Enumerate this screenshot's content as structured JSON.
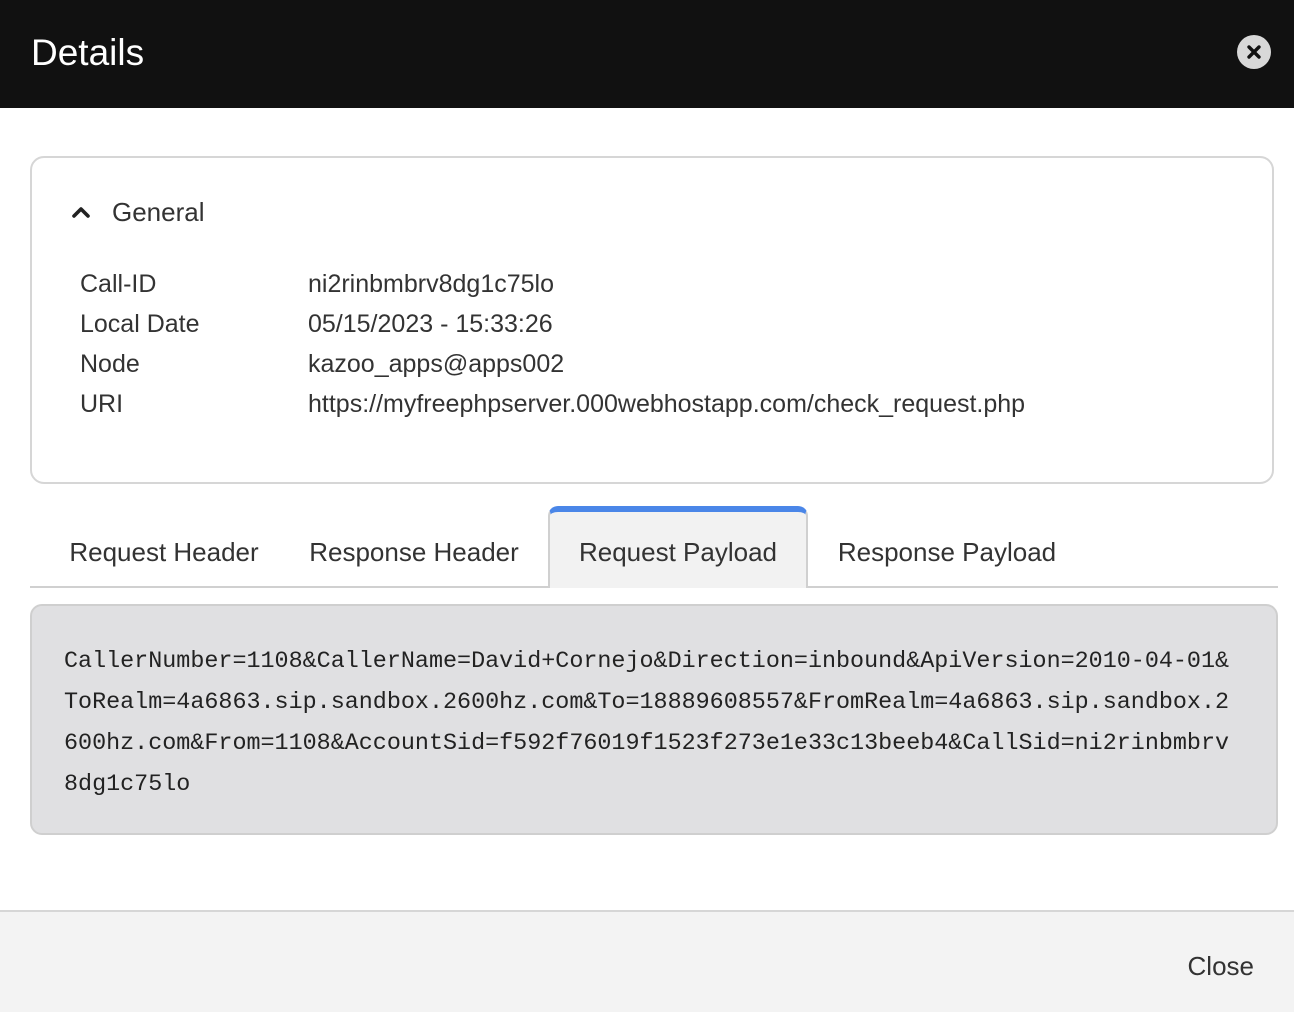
{
  "dialog": {
    "title": "Details",
    "close_icon": "close-circle-icon"
  },
  "general": {
    "title": "General",
    "expanded": true,
    "toggle_icon": "chevron-up-icon",
    "fields": [
      {
        "label": "Call-ID",
        "value": "ni2rinbmbrv8dg1c75lo"
      },
      {
        "label": "Local Date",
        "value": "05/15/2023 - 15:33:26"
      },
      {
        "label": "Node",
        "value": "kazoo_apps@apps002"
      },
      {
        "label": "URI",
        "value": "https://myfreephpserver.000webhostapp.com/check_request.php"
      }
    ]
  },
  "tabs": {
    "items": [
      {
        "label": "Request Header",
        "active": false
      },
      {
        "label": "Response Header",
        "active": false
      },
      {
        "label": "Request Payload",
        "active": true
      },
      {
        "label": "Response Payload",
        "active": false
      }
    ],
    "accent_color": "#4a86e8"
  },
  "payload": {
    "text": "CallerNumber=1108&CallerName=David+Cornejo&Direction=inbound&ApiVersion=2010-04-01&ToRealm=4a6863.sip.sandbox.2600hz.com&To=18889608557&FromRealm=4a6863.sip.sandbox.2600hz.com&From=1108&AccountSid=f592f76019f1523f273e1e33c13beeb4&CallSid=ni2rinbmbrv8dg1c75lo"
  },
  "footer": {
    "close_label": "Close"
  }
}
